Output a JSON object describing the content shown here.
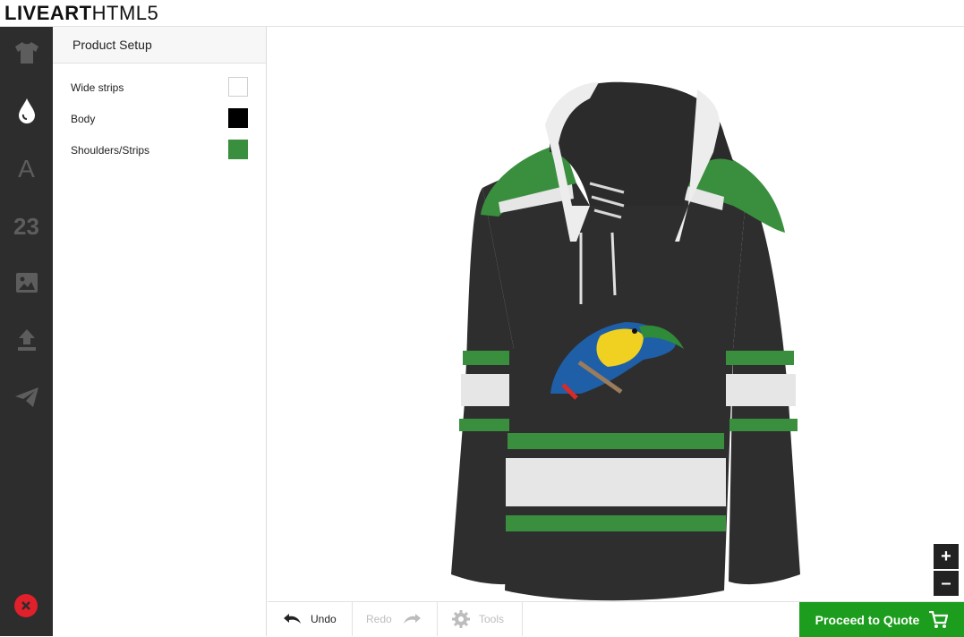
{
  "app": {
    "logo_bold": "LIVEART",
    "logo_light": "HTML5"
  },
  "leftnav": {
    "items": [
      {
        "icon": "tshirt-icon"
      },
      {
        "icon": "drop-icon"
      },
      {
        "icon": "text-icon",
        "label": "A"
      },
      {
        "icon": "number-icon",
        "label": "23"
      },
      {
        "icon": "image-icon"
      },
      {
        "icon": "upload-icon"
      },
      {
        "icon": "send-icon"
      }
    ],
    "close_icon": "close-icon"
  },
  "panel": {
    "title": "Product Setup",
    "colors": [
      {
        "label": "Wide strips",
        "color": "#ffffff"
      },
      {
        "label": "Body",
        "color": "#000000"
      },
      {
        "label": "Shoulders/Strips",
        "color": "#3a8f3f"
      }
    ]
  },
  "zoom": {
    "in_label": "+",
    "out_label": "–"
  },
  "toolbar": {
    "undo_label": "Undo",
    "redo_label": "Redo",
    "tools_label": "Tools",
    "quote_label": "Proceed to Quote"
  }
}
